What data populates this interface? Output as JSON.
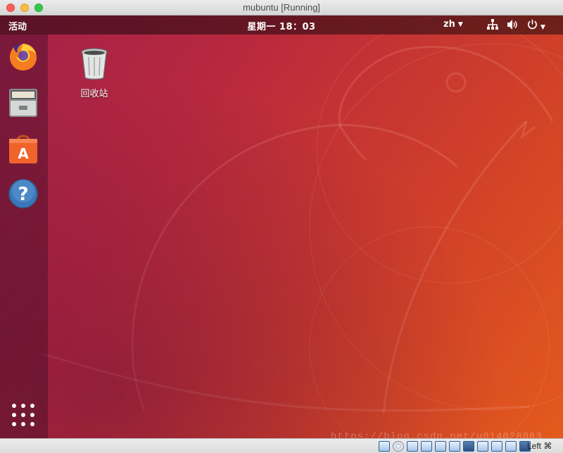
{
  "window": {
    "title": "mubuntu [Running]"
  },
  "topbar": {
    "activities_label": "活动",
    "clock": "星期一 18：03",
    "language": "zh"
  },
  "dock": {
    "items": [
      {
        "name": "firefox",
        "icon": "firefox-icon"
      },
      {
        "name": "files",
        "icon": "file-cabinet-icon"
      },
      {
        "name": "software",
        "icon": "shopping-bag-icon"
      },
      {
        "name": "help",
        "icon": "help-icon"
      }
    ],
    "show_apps_icon": "grid-icon"
  },
  "desktop": {
    "trash_label": "回收站"
  },
  "statusbar": {
    "host_key": "Left ⌘"
  },
  "watermark": "https://blog.csdn.net/u014028063",
  "colors": {
    "wallpaper_start": "#a3214a",
    "wallpaper_end": "#e35a1c",
    "topbar": "#2a0a0e"
  }
}
